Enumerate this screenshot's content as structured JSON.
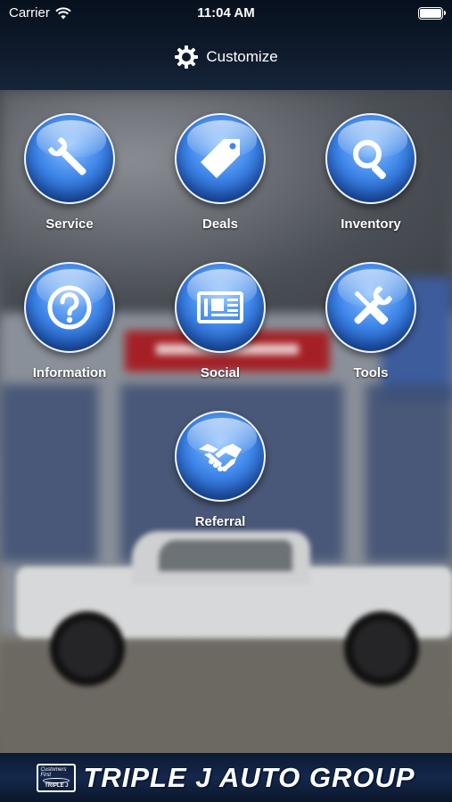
{
  "status_bar": {
    "carrier": "Carrier",
    "time": "11:04 AM"
  },
  "header": {
    "customize_label": "Customize"
  },
  "menu": {
    "items": [
      {
        "label": "Service",
        "icon": "wrench-icon"
      },
      {
        "label": "Deals",
        "icon": "price-tag-icon"
      },
      {
        "label": "Inventory",
        "icon": "magnifier-icon"
      },
      {
        "label": "Information",
        "icon": "question-mark-icon"
      },
      {
        "label": "Social",
        "icon": "newspaper-icon"
      },
      {
        "label": "Tools",
        "icon": "wrench-screwdriver-icon"
      },
      {
        "label": "Referral",
        "icon": "handshake-icon"
      }
    ]
  },
  "footer": {
    "brand_text": "TRIPLE J AUTO GROUP",
    "badge_top": "Customers First",
    "badge_bottom": "TRIPLE J"
  },
  "colors": {
    "orb_blue": "#3e86e8",
    "header_bg": "#0f1b2c",
    "footer_bg": "#15284c"
  }
}
